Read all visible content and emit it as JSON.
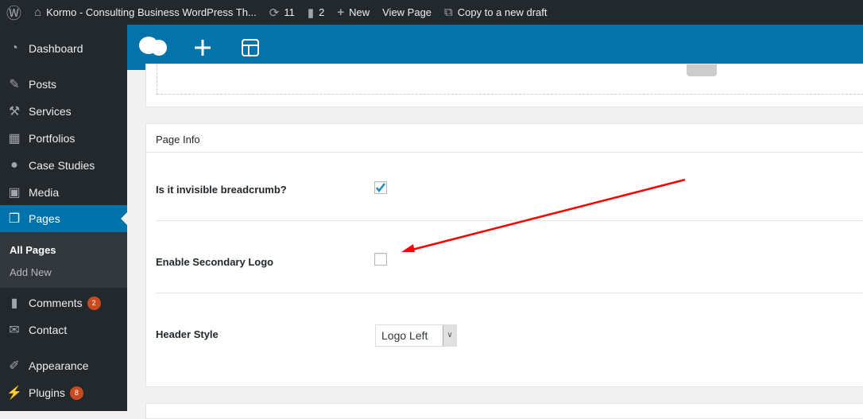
{
  "adminbar": {
    "site_title": "Kormo - Consulting Business WordPress Th...",
    "updates": "11",
    "comments": "2",
    "new_label": "New",
    "view_page": "View Page",
    "copy_draft": "Copy to a new draft"
  },
  "sidebar": {
    "items": [
      {
        "label": "Dashboard",
        "icon": "dashboard-icon"
      },
      {
        "label": "Posts",
        "icon": "pin-icon"
      },
      {
        "label": "Services",
        "icon": "hammer-icon"
      },
      {
        "label": "Portfolios",
        "icon": "grid-icon"
      },
      {
        "label": "Case Studies",
        "icon": "chat-icon"
      },
      {
        "label": "Media",
        "icon": "media-icon"
      },
      {
        "label": "Pages",
        "icon": "pages-icon"
      },
      {
        "label": "Comments",
        "icon": "comment-icon",
        "badge": "2"
      },
      {
        "label": "Contact",
        "icon": "mail-icon"
      },
      {
        "label": "Appearance",
        "icon": "brush-icon"
      },
      {
        "label": "Plugins",
        "icon": "plug-icon",
        "badge": "8"
      }
    ],
    "submenu": [
      "All Pages",
      "Add New"
    ]
  },
  "panel": {
    "title": "Page Info",
    "fields": [
      {
        "label": "Is it invisible breadcrumb?",
        "checked": true
      },
      {
        "label": "Enable Secondary Logo",
        "checked": false
      },
      {
        "label": "Header Style",
        "value": "Logo Left"
      }
    ]
  },
  "colors": {
    "accent": "#0073aa",
    "builder": "#0473aa",
    "annotation": "#ff0000"
  }
}
